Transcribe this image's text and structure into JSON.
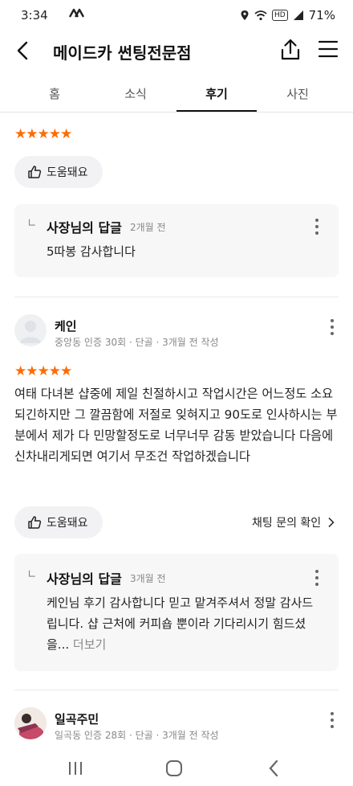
{
  "status_bar": {
    "time": "3:34",
    "notif_icons": "ᨓᨓ",
    "battery": "71%",
    "hd_label": "HD"
  },
  "app_bar": {
    "title": "메이드카 썬팅전문점"
  },
  "tabs": [
    {
      "label": "홈"
    },
    {
      "label": "소식"
    },
    {
      "label": "후기",
      "active": true
    },
    {
      "label": "사진"
    }
  ],
  "reviews": [
    {
      "stars": 5,
      "helpful_label": "도움돼요",
      "reply": {
        "owner_label": "사장님의 답글",
        "time": "2개월 전",
        "text": "5따봉 감사합니다"
      }
    },
    {
      "user_name": "케인",
      "user_meta": "중앙동 인증 30회 · 단골 · 3개월 전 작성",
      "stars": 5,
      "body": "여태 다녀본 샵중에 제일 친절하시고 작업시간은 어느정도 소요되긴하지만 그 깔끔함에 저절로 잊혀지고 90도로 인사하시는 부분에서 제가 다 민망할정도로 너무너무 감동 받았습니다 다음에 신차내리게되면 여기서 무조건 작업하겠습니다",
      "helpful_label": "도움돼요",
      "inquiry_label": "채팅 문의 확인",
      "reply": {
        "owner_label": "사장님의 답글",
        "time": "3개월 전",
        "text": "케인님 후기 감사합니다 믿고 맡겨주셔서 정말 감사드립니다. 샵 근처에 커피숍 뿐이라 기다리시기 힘드셨을...",
        "more_label": "더보기"
      }
    },
    {
      "user_name": "일곡주민",
      "user_meta": "일곡동 인증 28회 · 단골 · 3개월 전 작성"
    }
  ],
  "colors": {
    "star": "#ff6b00",
    "reply_bg": "#f7f7f8",
    "helpful_bg": "#f2f2f4"
  }
}
